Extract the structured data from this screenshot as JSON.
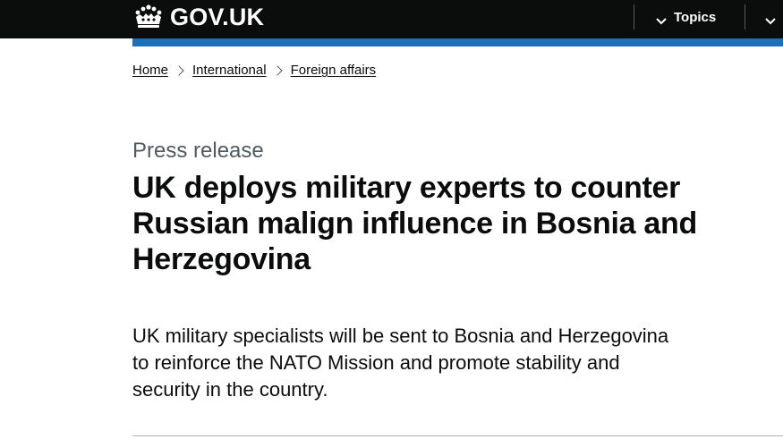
{
  "header": {
    "logo_text": "GOV.UK",
    "logo_icon": "crown-icon",
    "topics_label": "Topics",
    "topics_icon": "chevron-down-icon",
    "search_icon": "chevron-down-icon"
  },
  "breadcrumb": {
    "items": [
      {
        "label": "Home"
      },
      {
        "label": "International"
      },
      {
        "label": "Foreign affairs"
      }
    ]
  },
  "main": {
    "caption": "Press release",
    "title": "UK deploys military experts to counter Russian malign influence in Bosnia and Herzegovina",
    "lede": "UK military specialists will be sent to Bosnia and Herzegovina to reinforce the NATO Mission and promote stability and security in the country."
  },
  "colors": {
    "header_bg": "#0b0c0c",
    "accent_bar": "#1d70b8",
    "caption_text": "#505a5f",
    "body_text": "#0b0c0c"
  }
}
